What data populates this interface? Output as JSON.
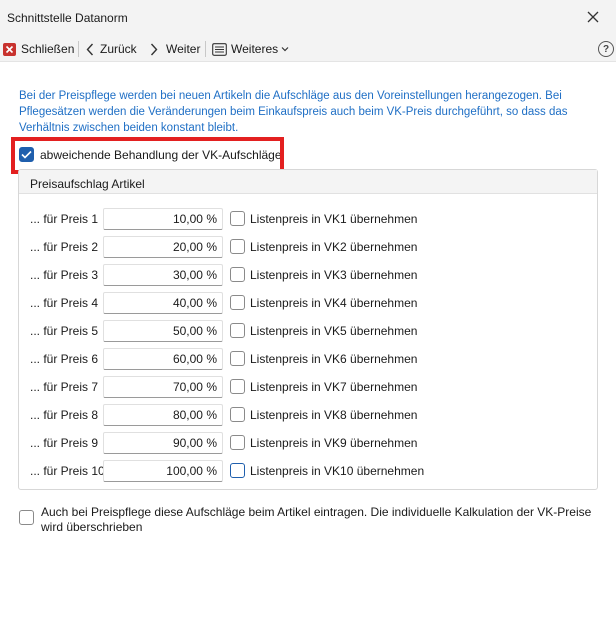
{
  "window": {
    "title": "Schnittstelle Datanorm"
  },
  "toolbar": {
    "close_label": "Schließen",
    "back_label": "Zurück",
    "next_label": "Weiter",
    "more_label": "Weiteres"
  },
  "info_text": "Bei der Preispflege werden bei neuen Artikeln die Aufschläge aus den Voreinstellungen herangezogen. Bei Pflegesätzen werden die Veränderungen beim Einkaufspreis auch beim VK-Preis durchgeführt, so dass das Verhältnis zwischen beiden konstant bleibt.",
  "deviating_handling": {
    "label": "abweichende Behandlung der VK-Aufschläge",
    "checked": true
  },
  "group": {
    "title": "Preisaufschlag Artikel",
    "rows": [
      {
        "label": "... für Preis 1",
        "value": "10,00 %",
        "cb_label": "Listenpreis in VK1 übernehmen"
      },
      {
        "label": "... für Preis 2",
        "value": "20,00 %",
        "cb_label": "Listenpreis in VK2 übernehmen"
      },
      {
        "label": "... für Preis 3",
        "value": "30,00 %",
        "cb_label": "Listenpreis in VK3 übernehmen"
      },
      {
        "label": "... für Preis 4",
        "value": "40,00 %",
        "cb_label": "Listenpreis in VK4 übernehmen"
      },
      {
        "label": "... für Preis 5",
        "value": "50,00 %",
        "cb_label": "Listenpreis in VK5 übernehmen"
      },
      {
        "label": "... für Preis 6",
        "value": "60,00 %",
        "cb_label": "Listenpreis in VK6 übernehmen"
      },
      {
        "label": "... für Preis 7",
        "value": "70,00 %",
        "cb_label": "Listenpreis in VK7 übernehmen"
      },
      {
        "label": "... für Preis 8",
        "value": "80,00 %",
        "cb_label": "Listenpreis in VK8 übernehmen"
      },
      {
        "label": "... für Preis 9",
        "value": "90,00 %",
        "cb_label": "Listenpreis in VK9 übernehmen"
      },
      {
        "label": "... für Preis 10",
        "value": "100,00 %",
        "cb_label": "Listenpreis in VK10 übernehmen"
      }
    ]
  },
  "bottom_check": {
    "label": "Auch bei Preispflege diese Aufschläge beim Artikel eintragen. Die individuelle Kalkulation der VK-Preise wird überschrieben",
    "checked": false
  },
  "icons": {
    "close": "close-x-icon",
    "close_red": "close-square-icon",
    "back": "chevron-left-icon",
    "next": "chevron-right-icon",
    "more": "list-icon",
    "dropdown": "chevron-down-icon",
    "help": "help-icon",
    "checkmark": "checkmark-icon"
  },
  "colors": {
    "accent": "#1f5fad",
    "info_text": "#1f6fc5",
    "highlight": "#e32020",
    "close_button": "#c8322e"
  }
}
